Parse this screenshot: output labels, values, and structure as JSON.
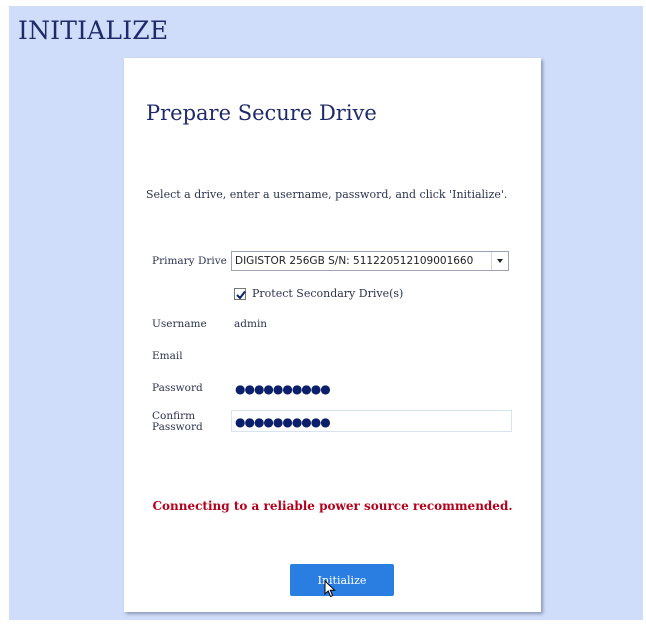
{
  "page": {
    "title": "INITIALIZE"
  },
  "card": {
    "title": "Prepare Secure Drive",
    "instructions": "Select a drive, enter a username, password, and click 'Initialize'."
  },
  "form": {
    "primary_drive": {
      "label": "Primary Drive",
      "value": "DIGISTOR 256GB S/N: 511220512109001660"
    },
    "protect_secondary": {
      "label": "Protect Secondary Drive(s)",
      "checked": true
    },
    "username": {
      "label": "Username",
      "value": "admin"
    },
    "email": {
      "label": "Email",
      "value": ""
    },
    "password": {
      "label": "Password",
      "masked": "●●●●●●●●●●"
    },
    "confirm_password": {
      "label_line1": "Confirm",
      "label_line2": "Password",
      "masked": "●●●●●●●●●●"
    }
  },
  "warning": "Connecting to a reliable power source recommended.",
  "buttons": {
    "initialize": "Initialize"
  },
  "colors": {
    "background": "#cfdcfa",
    "accent": "#2a7de1",
    "warning": "#b3001b",
    "title": "#1f2a6b"
  },
  "icons": {
    "dropdown": "chevron-down-icon",
    "checkbox": "checkmark-icon",
    "cursor": "mouse-pointer-icon"
  }
}
